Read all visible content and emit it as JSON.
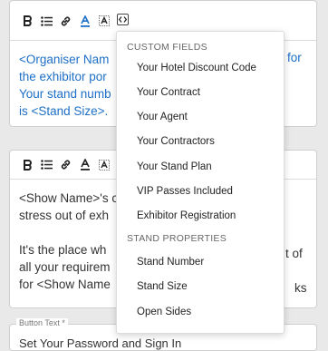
{
  "editor1": {
    "lines": [
      "<Organiser Nam",
      "the exhibitor por",
      "Your stand numb",
      "is <Stand Size>."
    ],
    "right_fragment": "for"
  },
  "editor2": {
    "lines": [
      "<Show Name>'s c",
      "stress out of exh"
    ],
    "lines2": [
      "It's the place wh",
      "all your requirem",
      "for <Show Name"
    ],
    "right_fragments": [
      "t of",
      "ks"
    ]
  },
  "button_text": {
    "label": "Button Text *",
    "value": "Set Your Password and Sign In"
  },
  "dropdown": {
    "sections": [
      {
        "header": "CUSTOM FIELDS",
        "items": [
          "Your Hotel Discount Code",
          "Your Contract",
          "Your Agent",
          "Your Contractors",
          "Your Stand Plan",
          "VIP Passes Included",
          "Exhibitor Registration"
        ]
      },
      {
        "header": "STAND PROPERTIES",
        "items": [
          "Stand Number",
          "Stand Size",
          "Open Sides"
        ]
      }
    ]
  },
  "toolbar_icons": [
    "bold-icon",
    "list-icon",
    "link-icon",
    "text-color-icon",
    "clear-format-icon",
    "embed-code-icon"
  ]
}
